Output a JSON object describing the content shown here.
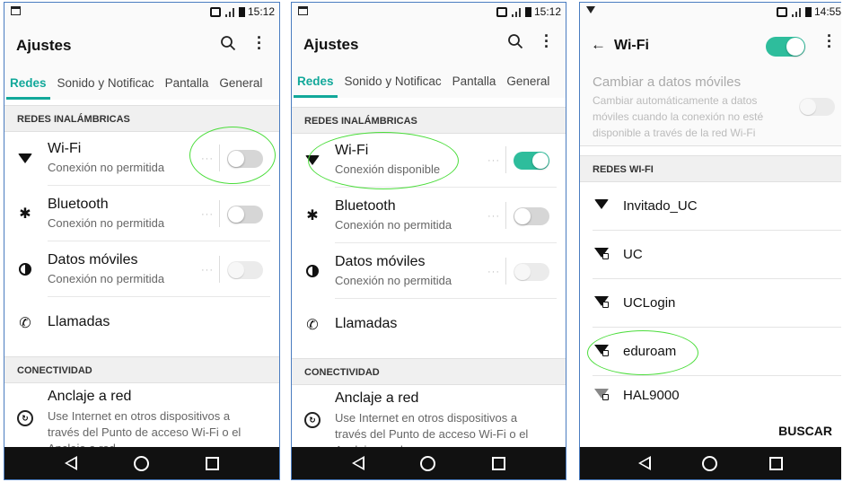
{
  "status": {
    "time_a": "15:12",
    "time_b": "15:12",
    "time_c": "14:55"
  },
  "settings": {
    "title": "Ajustes",
    "tabs": [
      "Redes",
      "Sonido y Notificac",
      "Pantalla",
      "General"
    ],
    "section_wireless": "REDES INALÁMBRICAS",
    "wifi_label": "Wi-Fi",
    "wifi_status_off": "Conexión no permitida",
    "wifi_status_on": "Conexión disponible",
    "bluetooth_label": "Bluetooth",
    "bluetooth_status": "Conexión no permitida",
    "mobile_label": "Datos móviles",
    "mobile_status": "Conexión no permitida",
    "calls_label": "Llamadas",
    "section_connectivity": "CONECTIVIDAD",
    "tether_label": "Anclaje a red",
    "tether_desc": "Use Internet en otros dispositivos a través del Punto de acceso Wi-Fi o el Anclaje a red"
  },
  "wifi_screen": {
    "title": "Wi-Fi",
    "mobile_data_title": "Cambiar a datos móviles",
    "mobile_data_desc": "Cambiar automáticamente a datos móviles cuando la conexión no esté disponible a través de la red Wi-Fi",
    "section": "REDES WI-FI",
    "networks": [
      "Invitado_UC",
      "UC",
      "UCLogin",
      "eduroam",
      "HAL9000"
    ],
    "scan_button": "BUSCAR"
  },
  "toggles": {
    "p1_wifi": false,
    "p2_wifi": true,
    "wifi_master": true
  },
  "colors": {
    "accent": "#12a89a",
    "toggle_on": "#2ebd9c",
    "highlight_circle": "#4cdd3c",
    "frame": "#4a7cc0"
  }
}
